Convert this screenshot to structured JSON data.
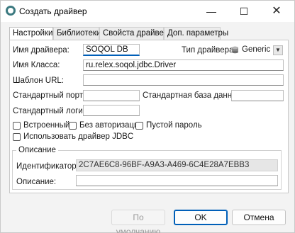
{
  "window": {
    "title": "Создать драйвер"
  },
  "titlebar": {
    "minimize": "—",
    "maximize": "☐",
    "close": "✕"
  },
  "tabs": [
    {
      "label": "Настройки",
      "active": true
    },
    {
      "label": "Библиотеки",
      "active": false
    },
    {
      "label": "Свойста драйвера",
      "active": false
    },
    {
      "label": "Доп. параметры",
      "active": false
    }
  ],
  "form": {
    "driver_name_label": "Имя драйвера:",
    "driver_name_value": "SOQOL DB",
    "driver_type_label": "Тип драйвера:",
    "driver_type_value": "Generic",
    "class_name_label": "Имя Класса:",
    "class_name_value": "ru.relex.soqol.jdbc.Driver",
    "url_template_label": "Шаблон URL:",
    "url_template_value": "",
    "default_port_label": "Стандартный порт:",
    "default_port_value": "",
    "default_db_label": "Стандартная база данных:",
    "default_db_value": "",
    "default_login_label": "Стандартный логин:",
    "default_login_value": ""
  },
  "checkboxes": {
    "embedded": "Встроенный",
    "no_auth": "Без авторизации",
    "empty_password": "Пустой пароль",
    "use_jdbc": "Использовать драйвер JDBC"
  },
  "description_group": {
    "title": "Описание",
    "id_label": "Идентификатор:",
    "id_value": "2C7AE6C8-96BF-A9A3-A469-6C4E28A7EBB3",
    "desc_label": "Описание:",
    "desc_value": ""
  },
  "buttons": {
    "default": "По умолчанию",
    "ok": "OK",
    "cancel": "Отмена"
  }
}
